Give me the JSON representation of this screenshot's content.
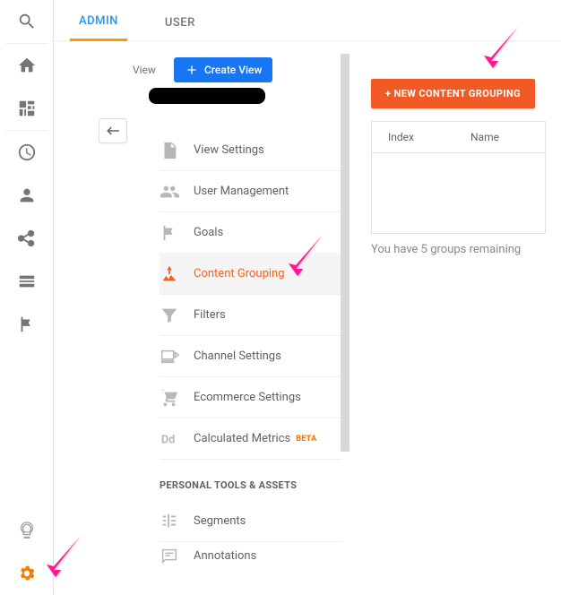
{
  "tabs": {
    "admin": "ADMIN",
    "user": "USER"
  },
  "view": {
    "label": "View",
    "create_button": "Create View"
  },
  "menu": {
    "view_settings": "View Settings",
    "user_management": "User Management",
    "goals": "Goals",
    "content_grouping": "Content Grouping",
    "filters": "Filters",
    "channel_settings": "Channel Settings",
    "ecommerce_settings": "Ecommerce Settings",
    "calculated_metrics": "Calculated Metrics",
    "beta": "BETA",
    "section": "PERSONAL TOOLS & ASSETS",
    "segments": "Segments",
    "annotations": "Annotations"
  },
  "right": {
    "new_button": "+ NEW CONTENT GROUPING",
    "col_index": "Index",
    "col_name": "Name",
    "remaining": "You have 5 groups remaining"
  }
}
